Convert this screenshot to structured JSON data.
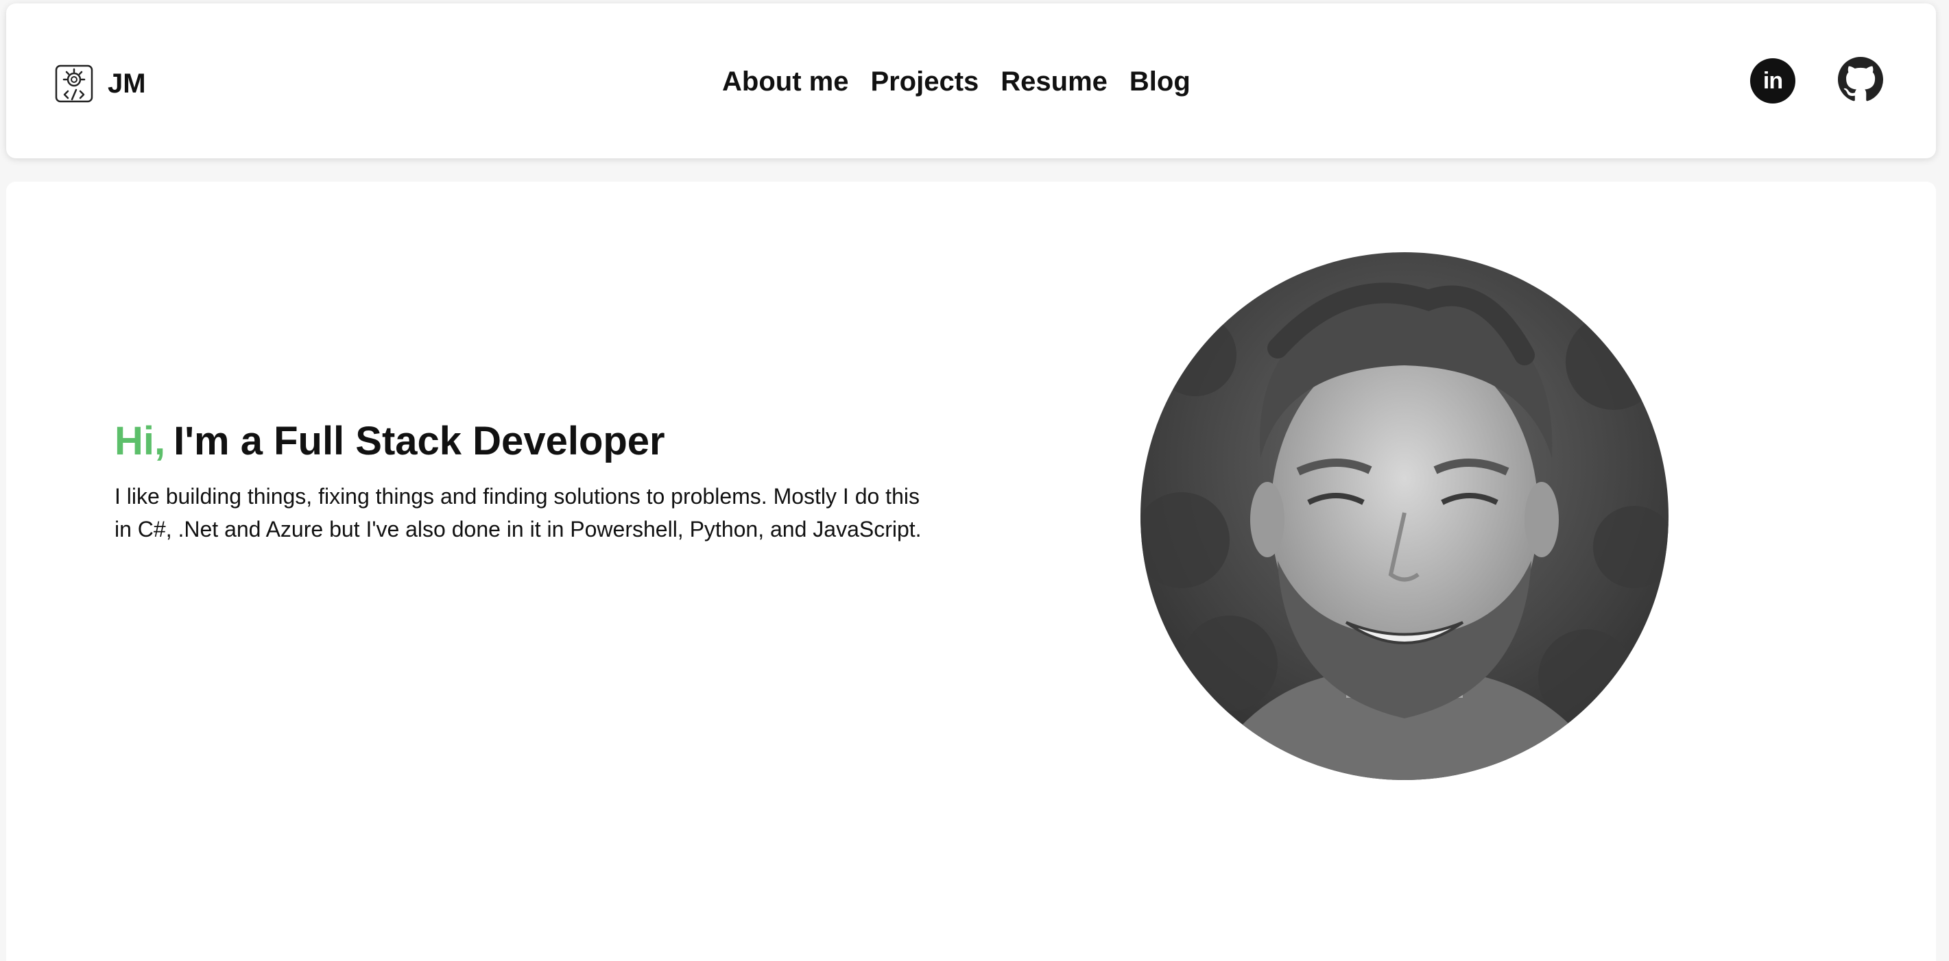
{
  "brand": {
    "initials": "JM",
    "logo_icon": "gear-code-icon"
  },
  "nav": {
    "items": [
      {
        "label": "About me"
      },
      {
        "label": "Projects"
      },
      {
        "label": "Resume"
      },
      {
        "label": "Blog"
      }
    ]
  },
  "social": {
    "linkedin_icon": "linkedin-icon",
    "linkedin_text": "in",
    "github_icon": "github-icon"
  },
  "hero": {
    "greeting": "Hi,",
    "title": "I'm a Full Stack Developer",
    "intro": "I like building things, fixing things and finding solutions to problems. Mostly I do this in C#, .Net and Azure but I've also done in it in Powershell, Python, and JavaScript.",
    "accent_color": "#5cbf6a",
    "portrait_icon": "profile-photo"
  }
}
